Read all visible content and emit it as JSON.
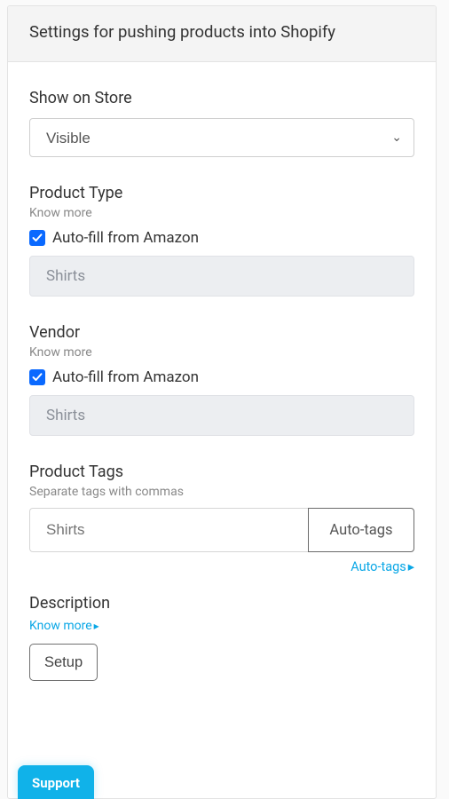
{
  "header": {
    "title": "Settings for pushing products into Shopify"
  },
  "showOnStore": {
    "label": "Show on Store",
    "value": "Visible"
  },
  "productType": {
    "label": "Product Type",
    "hint": "Know more",
    "autofillLabel": "Auto-fill from Amazon",
    "value": "Shirts"
  },
  "vendor": {
    "label": "Vendor",
    "hint": "Know more",
    "autofillLabel": "Auto-fill from Amazon",
    "value": "Shirts"
  },
  "productTags": {
    "label": "Product Tags",
    "hint": "Separate tags with commas",
    "placeholder": "Shirts",
    "buttonLabel": "Auto-tags",
    "linkLabel": "Auto-tags"
  },
  "description": {
    "label": "Description",
    "hint": "Know more",
    "buttonLabel": "Setup"
  },
  "support": {
    "label": "Support"
  }
}
